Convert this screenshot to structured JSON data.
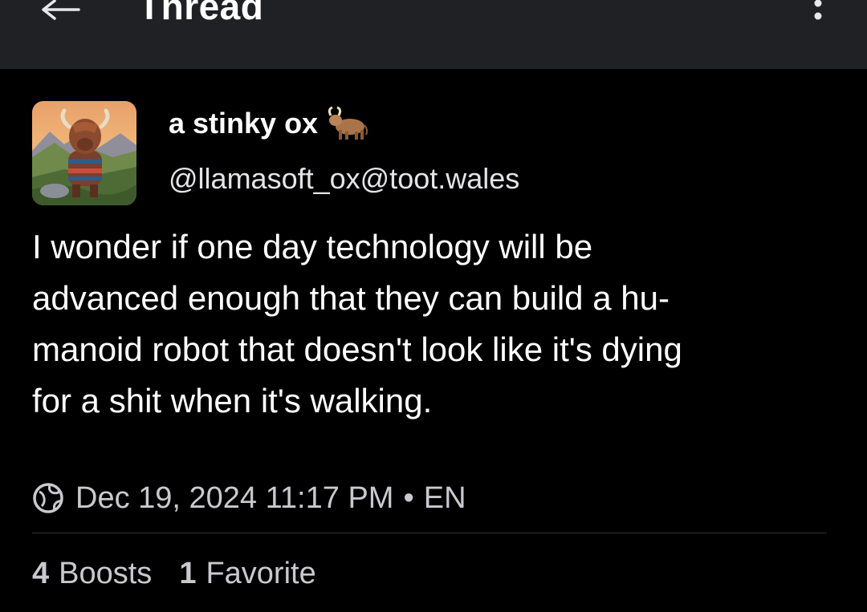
{
  "header": {
    "title": "Thread",
    "back_icon": "arrow-left-icon",
    "more_icon": "more-vertical-icon"
  },
  "post": {
    "author": {
      "display_name": "a stinky ox",
      "name_emoji": "ox-emoji-icon",
      "handle": "@llamasoft_ox@toot.wales",
      "avatar": "highland-cow-avatar"
    },
    "content_lines": [
      "I wonder if one day technology will be",
      "advanced enough that they can build a hu-",
      "manoid robot that doesn't look like it's dying",
      "for a shit when it's walking."
    ],
    "meta": {
      "visibility_icon": "globe-icon",
      "timestamp": "Dec 19, 2024 11:17 PM",
      "separator": "•",
      "language": "EN"
    },
    "stats": {
      "boosts_count": "4",
      "boosts_label": "Boosts",
      "favorites_count": "1",
      "favorites_label": "Favorite"
    }
  },
  "colors": {
    "background": "#000000",
    "topbar": "#1f2125",
    "text": "#ffffff",
    "secondary_text": "#c9c9cf"
  }
}
